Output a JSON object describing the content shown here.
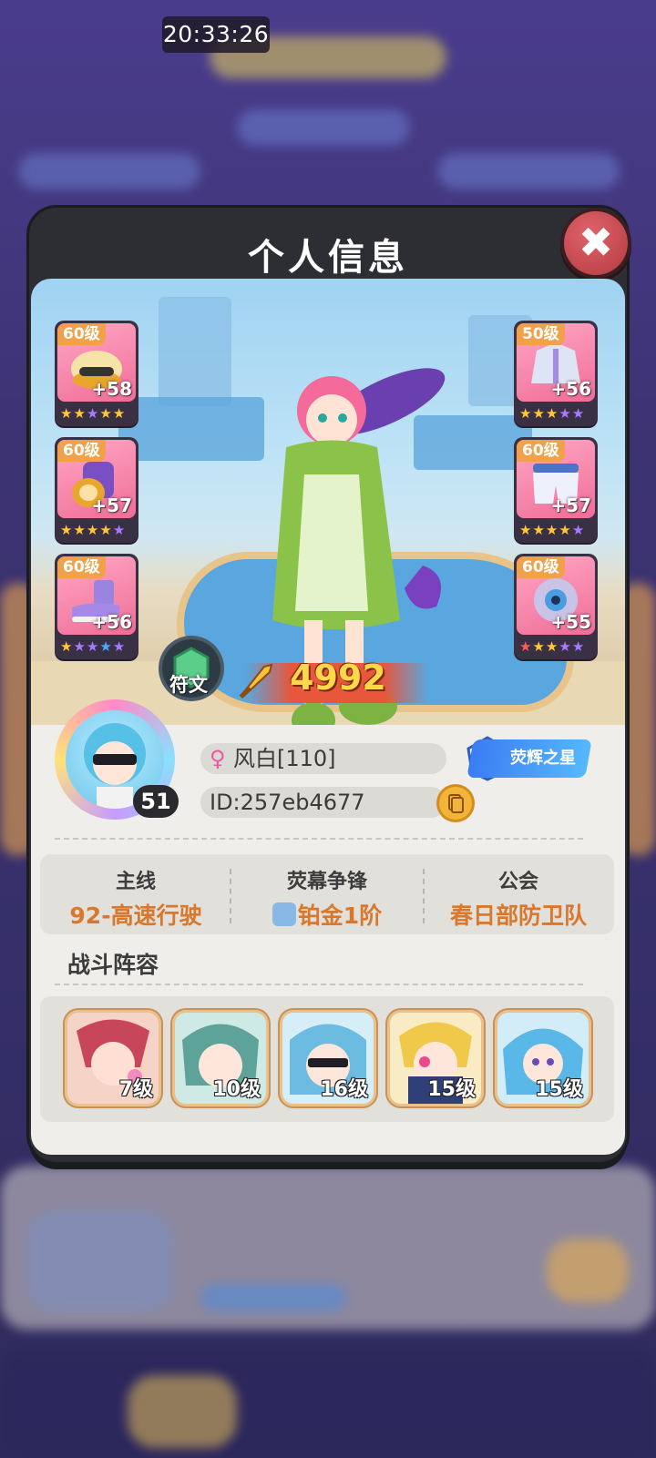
{
  "status": {
    "time": "20:33:26"
  },
  "dialog": {
    "title": "个人信息",
    "close_icon": "close-icon"
  },
  "equipment": {
    "left": [
      {
        "level": "60级",
        "plus": "+58",
        "item": "helmet",
        "stars": [
          "gold",
          "gold",
          "purple",
          "gold",
          "gold"
        ]
      },
      {
        "level": "60级",
        "plus": "+57",
        "item": "bracer",
        "stars": [
          "gold",
          "gold",
          "gold",
          "gold",
          "purple"
        ]
      },
      {
        "level": "60级",
        "plus": "+56",
        "item": "boots",
        "stars": [
          "gold",
          "purple",
          "purple",
          "blue",
          "purple"
        ]
      }
    ],
    "right": [
      {
        "level": "50级",
        "plus": "+56",
        "item": "jacket",
        "stars": [
          "gold",
          "gold",
          "gold",
          "purple",
          "purple"
        ]
      },
      {
        "level": "60级",
        "plus": "+57",
        "item": "shorts",
        "stars": [
          "gold",
          "gold",
          "gold",
          "gold",
          "purple"
        ]
      },
      {
        "level": "60级",
        "plus": "+55",
        "item": "gadget",
        "stars": [
          "red",
          "gold",
          "gold",
          "purple",
          "purple"
        ]
      }
    ]
  },
  "rune": {
    "label": "符文"
  },
  "power": {
    "value": "4992"
  },
  "player": {
    "level": "51",
    "name": "风白[110]",
    "id": "ID:257eb4677",
    "badge": "荧辉之星"
  },
  "stats": [
    {
      "label": "主线",
      "value": "92-高速行驶"
    },
    {
      "label": "荧幕争锋",
      "value": "铂金1阶"
    },
    {
      "label": "公会",
      "value": "春日部防卫队"
    }
  ],
  "lineup": {
    "title": "战斗阵容",
    "heroes": [
      {
        "level": "7级",
        "accent": "#c8465a"
      },
      {
        "level": "10级",
        "accent": "#5ea39a"
      },
      {
        "level": "16级",
        "accent": "#6bbce0"
      },
      {
        "level": "15级",
        "accent": "#f0c94a"
      },
      {
        "level": "15级",
        "accent": "#5ab8e8"
      }
    ]
  }
}
